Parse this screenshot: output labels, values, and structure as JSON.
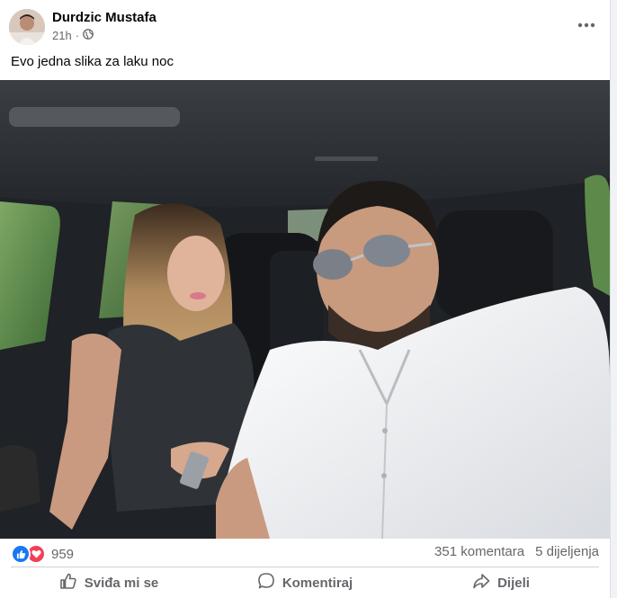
{
  "post": {
    "author": "Durdzic Mustafa",
    "time": "21h",
    "separator": "·",
    "privacy_icon": "globe-icon",
    "more_icon": "more-horizontal-icon",
    "caption": "Evo jedna slika za laku noc"
  },
  "photo": {
    "subject": "selfie-in-car"
  },
  "stats": {
    "reaction_count": "959",
    "comments": "351 komentara",
    "shares": "5 dijeljenja",
    "reaction_icons": [
      "like-icon",
      "love-icon"
    ]
  },
  "actions": {
    "like": "Sviđa mi se",
    "comment": "Komentiraj",
    "share": "Dijeli"
  },
  "colors": {
    "like_blue": "#1877f2",
    "love_red": "#f33e58",
    "secondary_text": "#65676b"
  }
}
